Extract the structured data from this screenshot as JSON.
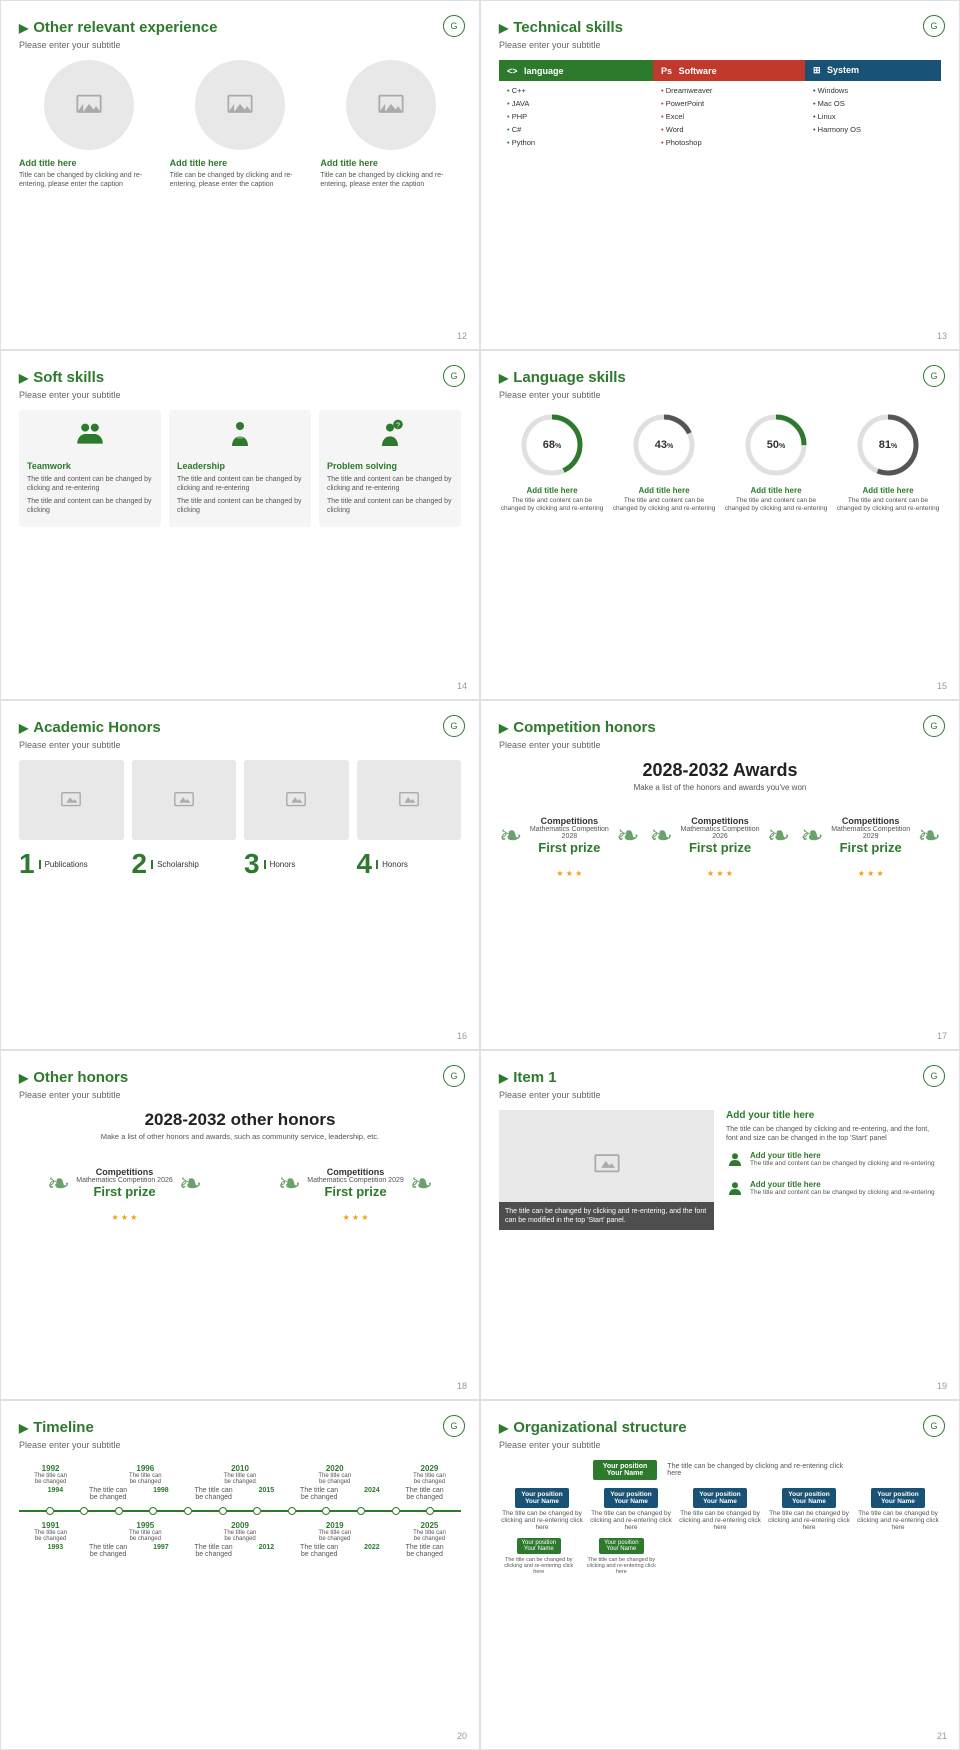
{
  "slides": {
    "s12": {
      "title": "Other relevant experience",
      "subtitle": "Please enter your subtitle",
      "num": "12",
      "cards": [
        {
          "title": "Add title here",
          "desc": "Title can be changed by clicking and re-entering, please enter the caption"
        },
        {
          "title": "Add title here",
          "desc": "Title can be changed by clicking and re-entering, please enter the caption"
        },
        {
          "title": "Add title here",
          "desc": "Title can be changed by clicking and re-entering, please enter the caption"
        }
      ]
    },
    "s13": {
      "title": "Technical skills",
      "subtitle": "Please enter your subtitle",
      "num": "13",
      "lang_header": "language",
      "sw_header": "Software",
      "sys_header": "System",
      "lang_items": [
        "C++",
        "JAVA",
        "PHP",
        "C#",
        "Python"
      ],
      "sw_items": [
        "Dreamweaver",
        "PowerPoint",
        "Excel",
        "Word",
        "Photoshop"
      ],
      "sys_items": [
        "Windows",
        "Mac OS",
        "Linux",
        "Harmony OS"
      ]
    },
    "s14": {
      "title": "Soft skills",
      "subtitle": "Please enter your subtitle",
      "num": "14",
      "cards": [
        {
          "title": "Teamwork",
          "desc": "The title and content can be changed by clicking and re-entering",
          "extra": "The title and content can be changed by clicking"
        },
        {
          "title": "Leadership",
          "desc": "The title and content can be changed by clicking and re-entering",
          "extra": "The title and content can be changed by clicking"
        },
        {
          "title": "Problem solving",
          "desc": "The title and content can be changed by clicking and re-entering",
          "extra": "The title and content can be changed by clicking"
        }
      ]
    },
    "s15": {
      "title": "Language skills",
      "subtitle": "Please enter your subtitle",
      "num": "15",
      "circles": [
        {
          "pct": 68,
          "label": "Add title here",
          "desc": "The title and content can be changed by clicking and re-entering"
        },
        {
          "pct": 43,
          "label": "Add title here",
          "desc": "The title and content can be changed by clicking and re-entering"
        },
        {
          "pct": 50,
          "label": "Add title here",
          "desc": "The title and content can be changed by clicking and re-entering"
        },
        {
          "pct": 81,
          "label": "Add title here",
          "desc": "The title and content can be changed by clicking and re-entering"
        }
      ]
    },
    "s16": {
      "title": "Academic Honors",
      "subtitle": "Please enter your subtitle",
      "num": "16",
      "items": [
        {
          "num": "1",
          "label": "Publications"
        },
        {
          "num": "2",
          "label": "Scholarship"
        },
        {
          "num": "3",
          "label": "Honors"
        },
        {
          "num": "4",
          "label": "Honors"
        }
      ]
    },
    "s17": {
      "title": "Competition honors",
      "subtitle": "Please enter your subtitle",
      "num": "17",
      "big_title": "2028-2032 Awards",
      "big_sub": "Make a list of the honors and awards you've won",
      "awards": [
        {
          "name": "Competitions",
          "event": "Mathematics Competition 2028",
          "prize": "First prize"
        },
        {
          "name": "Competitions",
          "event": "Mathematics Competition 2026",
          "prize": "First prize"
        },
        {
          "name": "Competitions",
          "event": "Mathematics Competition 2029",
          "prize": "First prize"
        }
      ]
    },
    "s18": {
      "title": "Other honors",
      "subtitle": "Please enter your subtitle",
      "num": "18",
      "big_title": "2028-2032 other honors",
      "big_sub": "Make a list of other honors and awards, such as community service, leadership, etc.",
      "awards": [
        {
          "name": "Competitions",
          "event": "Mathematics Competition 2026",
          "prize": "First prize"
        },
        {
          "name": "Competitions",
          "event": "Mathematics Competition 2029",
          "prize": "First prize"
        }
      ]
    },
    "s19": {
      "title": "Item 1",
      "subtitle": "Please enter your subtitle",
      "num": "19",
      "big_title": "Add your title here",
      "big_desc": "The title can be changed by clicking and re-entering, and the font, font and size can be changed in the top 'Start' panel",
      "caption": "The title can be changed by clicking and re-entering, and the font can be modified in the top 'Start' panel.",
      "persons": [
        {
          "title": "Add your title here",
          "desc": "The title and content can be changed by clicking and re-entering"
        },
        {
          "title": "Add your title here",
          "desc": "The title and content can be changed by clicking and re-entering"
        }
      ]
    },
    "s20": {
      "title": "Timeline",
      "subtitle": "Please enter your subtitle",
      "num": "20",
      "top_years": [
        "1992",
        "1996",
        "2010",
        "2020",
        "2029"
      ],
      "top_descs": [
        "The title can be changed",
        "The title can be changed",
        "The title can be changed",
        "The title can be changed",
        "The title can be changed"
      ],
      "bottom_years": [
        "1991",
        "1995",
        "2009",
        "2019",
        "2025"
      ],
      "bottom_descs": [
        "The title can be changed",
        "The title can be changed",
        "The title can be changed",
        "The title can be changed",
        "The title can be changed"
      ]
    },
    "s21": {
      "title": "Organizational structure",
      "subtitle": "Please enter your subtitle",
      "num": "21",
      "top_pos": "Your position",
      "top_name": "Your Name",
      "top_desc": "The title can be changed by clicking and re-entering click here",
      "mid_items": [
        {
          "pos": "Your position",
          "name": "Your Name",
          "desc": "The title can be changed by clicking and re-entering click here"
        },
        {
          "pos": "Your position",
          "name": "Your Name",
          "desc": "The title can be changed by clicking and re-entering click here"
        },
        {
          "pos": "Your position",
          "name": "Your Name",
          "desc": "The title can be changed by clicking and re-entering click here"
        },
        {
          "pos": "Your position",
          "name": "Your Name",
          "desc": "The title can be changed by clicking and re-entering click here"
        },
        {
          "pos": "Your position",
          "name": "Your Name",
          "desc": "The title can be changed by clicking and re-entering click here"
        }
      ],
      "bot_items": [
        {
          "pos": "Your position",
          "name": "Your Name",
          "desc": "The title can be changed by clicking and re-entering click here"
        },
        {
          "pos": "Your position",
          "name": "Your Name",
          "desc": "The title can be changed by clicking and re-entering click here"
        }
      ]
    }
  }
}
